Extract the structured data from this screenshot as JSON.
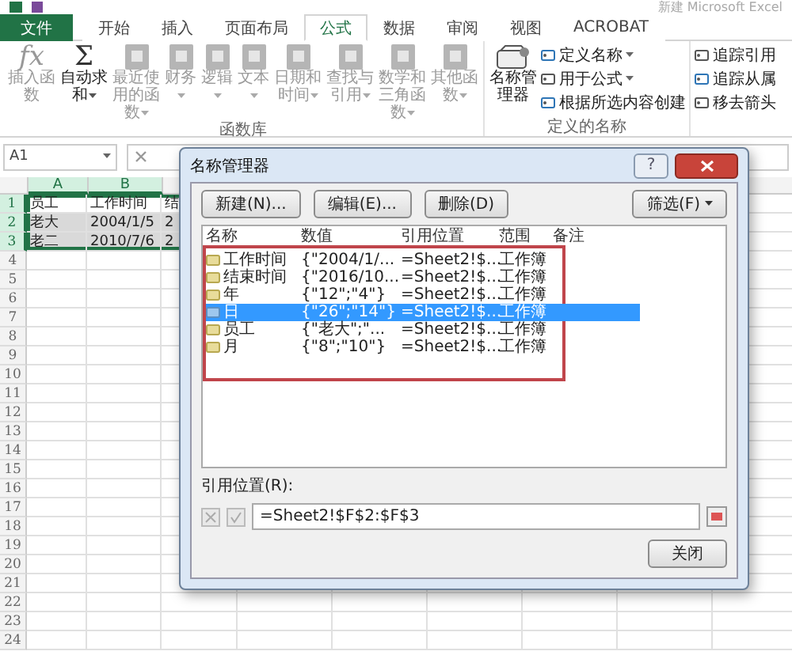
{
  "window": {
    "title": "新建 Microsoft Excel"
  },
  "tabs": [
    {
      "label": "文件",
      "kind": "file",
      "selected": false
    },
    {
      "label": "开始",
      "kind": "tab",
      "selected": false
    },
    {
      "label": "插入",
      "kind": "tab",
      "selected": false
    },
    {
      "label": "页面布局",
      "kind": "tab",
      "selected": false
    },
    {
      "label": "公式",
      "kind": "tab",
      "selected": true
    },
    {
      "label": "数据",
      "kind": "tab",
      "selected": false
    },
    {
      "label": "审阅",
      "kind": "tab",
      "selected": false
    },
    {
      "label": "视图",
      "kind": "tab",
      "selected": false
    },
    {
      "label": "ACROBAT",
      "kind": "tab",
      "selected": false
    }
  ],
  "ribbon": {
    "groups": [
      {
        "label": "函数库",
        "buttons": [
          {
            "kind": "big",
            "label": "插入函数",
            "glyph": "fx",
            "disabled": true,
            "menu": false
          },
          {
            "kind": "big",
            "label": "自动求和",
            "glyph": "Σ",
            "disabled": false,
            "menu": true
          },
          {
            "kind": "big",
            "label": "最近使用的函数",
            "disabled": true,
            "menu": true
          },
          {
            "kind": "big",
            "label": "财务",
            "disabled": true,
            "menu": true
          },
          {
            "kind": "big",
            "label": "逻辑",
            "disabled": true,
            "menu": true
          },
          {
            "kind": "big",
            "label": "文本",
            "disabled": true,
            "menu": true
          },
          {
            "kind": "big",
            "label": "日期和时间",
            "disabled": true,
            "menu": true
          },
          {
            "kind": "big",
            "label": "查找与引用",
            "disabled": true,
            "menu": true
          },
          {
            "kind": "big",
            "label": "数学和三角函数",
            "disabled": true,
            "menu": true
          },
          {
            "kind": "big",
            "label": "其他函数",
            "disabled": true,
            "menu": true
          }
        ]
      },
      {
        "label": "定义的名称",
        "buttons": [
          {
            "kind": "big",
            "label": "名称管理器",
            "disabled": false,
            "menu": false
          },
          {
            "kind": "small",
            "label": "定义名称",
            "disabled": false,
            "menu": true
          },
          {
            "kind": "small",
            "label": "用于公式",
            "disabled": false,
            "menu": true
          },
          {
            "kind": "small",
            "label": "根据所选内容创建",
            "disabled": false,
            "menu": false
          }
        ]
      },
      {
        "buttons": [
          {
            "kind": "small",
            "label": "追踪引用",
            "disabled": false,
            "menu": false
          },
          {
            "kind": "small",
            "label": "追踪从属",
            "disabled": false,
            "menu": false
          },
          {
            "kind": "small",
            "label": "移去箭头",
            "disabled": false,
            "menu": false
          }
        ]
      }
    ]
  },
  "name_box": "A1",
  "sheet": {
    "columns": [
      {
        "label": "A",
        "selected": true
      },
      {
        "label": "B",
        "selected": true
      }
    ],
    "rows": [
      {
        "header": "1",
        "selected": true,
        "cells": [
          {
            "text": "员工",
            "selected": false
          },
          {
            "text": "工作时间",
            "selected": false
          },
          {
            "text": "结",
            "selected": false
          }
        ]
      },
      {
        "header": "2",
        "selected": true,
        "cells": [
          {
            "text": "老大",
            "selected": true
          },
          {
            "text": "2004/1/5",
            "selected": true
          },
          {
            "text": "2",
            "selected": true
          }
        ]
      },
      {
        "header": "3",
        "selected": true,
        "cells": [
          {
            "text": "老二",
            "selected": true
          },
          {
            "text": "2010/7/6",
            "selected": true
          },
          {
            "text": "2",
            "selected": true
          }
        ]
      },
      {
        "header": "4",
        "selected": false
      },
      {
        "header": "5",
        "selected": false
      },
      {
        "header": "6",
        "selected": false
      },
      {
        "header": "7",
        "selected": false
      },
      {
        "header": "8",
        "selected": false
      },
      {
        "header": "9",
        "selected": false
      },
      {
        "header": "10",
        "selected": false
      },
      {
        "header": "11",
        "selected": false
      },
      {
        "header": "12",
        "selected": false
      },
      {
        "header": "13",
        "selected": false
      },
      {
        "header": "14",
        "selected": false
      },
      {
        "header": "15",
        "selected": false
      },
      {
        "header": "16",
        "selected": false
      },
      {
        "header": "17",
        "selected": false
      },
      {
        "header": "18",
        "selected": false
      },
      {
        "header": "19",
        "selected": false
      },
      {
        "header": "20",
        "selected": false
      },
      {
        "header": "21",
        "selected": false
      },
      {
        "header": "22",
        "selected": false
      },
      {
        "header": "23",
        "selected": false
      },
      {
        "header": "24",
        "selected": false
      }
    ]
  },
  "dialog": {
    "title": "名称管理器",
    "help": "?",
    "buttons": [
      "新建(N)...",
      "编辑(E)...",
      "删除(D)"
    ],
    "filter_button": "筛选(F)",
    "columns": [
      "名称",
      "数值",
      "引用位置",
      "范围",
      "备注"
    ],
    "rows": [
      {
        "name": "工作时间",
        "value": "{\"2004/1/...",
        "refers_to": "=Sheet2!$...",
        "scope": "工作簿",
        "selected": false
      },
      {
        "name": "结束时间",
        "value": "{\"2016/10...",
        "refers_to": "=Sheet2!$...",
        "scope": "工作簿",
        "selected": false
      },
      {
        "name": "年",
        "value": "{\"12\";\"4\"}",
        "refers_to": "=Sheet2!$...",
        "scope": "工作簿",
        "selected": false
      },
      {
        "name": "日",
        "value": "{\"26\";\"14\"}",
        "refers_to": "=Sheet2!$...",
        "scope": "工作簿",
        "selected": true
      },
      {
        "name": "员工",
        "value": "{\"老大\";\"...",
        "refers_to": "=Sheet2!$...",
        "scope": "工作簿",
        "selected": false
      },
      {
        "name": "月",
        "value": "{\"8\";\"10\"}",
        "refers_to": "=Sheet2!$...",
        "scope": "工作簿",
        "selected": false
      }
    ],
    "refers_label": "引用位置(R):",
    "refers_value": "=Sheet2!$F$2:$F$3",
    "close_button": "关闭"
  }
}
